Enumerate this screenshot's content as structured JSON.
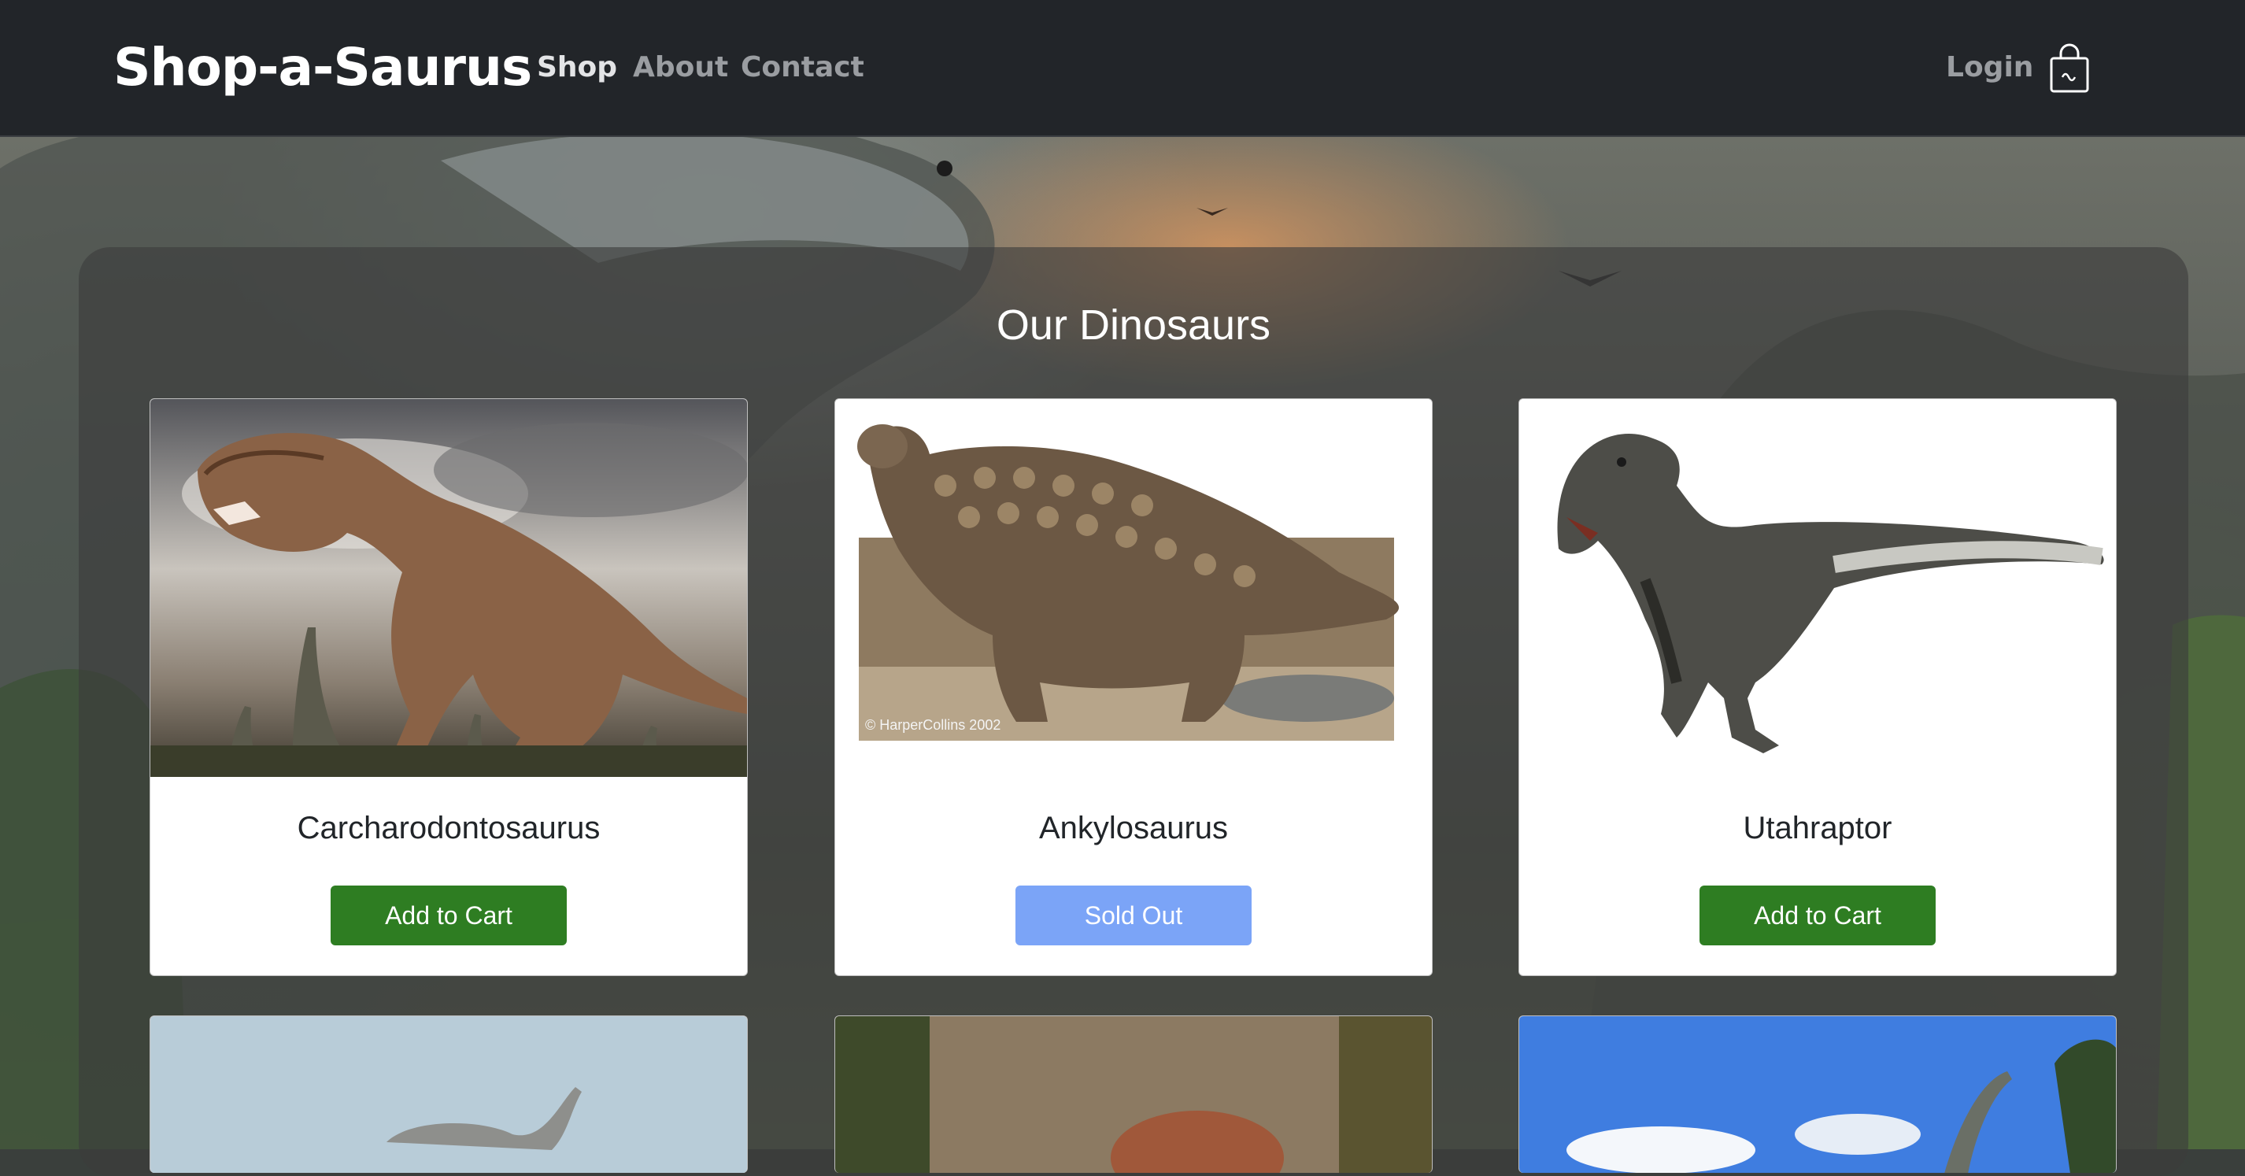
{
  "navbar": {
    "brand": "Shop-a-Saurus",
    "links": [
      {
        "label": "Shop",
        "active": true
      },
      {
        "label": "About",
        "active": false
      },
      {
        "label": "Contact",
        "active": false
      }
    ],
    "login_label": "Login",
    "cart_icon": "shopping-bag-icon"
  },
  "panel": {
    "title": "Our Dinosaurs"
  },
  "products": [
    {
      "name": "Carcharodontosaurus",
      "button": "Add to Cart",
      "status": "available",
      "image": "carcharodontosaurus-photo"
    },
    {
      "name": "Ankylosaurus",
      "button": "Sold Out",
      "status": "sold-out",
      "image": "ankylosaurus-photo",
      "image_caption": "© HarperCollins 2002"
    },
    {
      "name": "Utahraptor",
      "button": "Add to Cart",
      "status": "available",
      "image": "utahraptor-photo"
    }
  ],
  "colors": {
    "navbar_bg": "#222529",
    "add_button": "#2e7d22",
    "sold_button": "#7ba4f7",
    "panel_overlay": "rgba(60,60,60,0.62)"
  }
}
